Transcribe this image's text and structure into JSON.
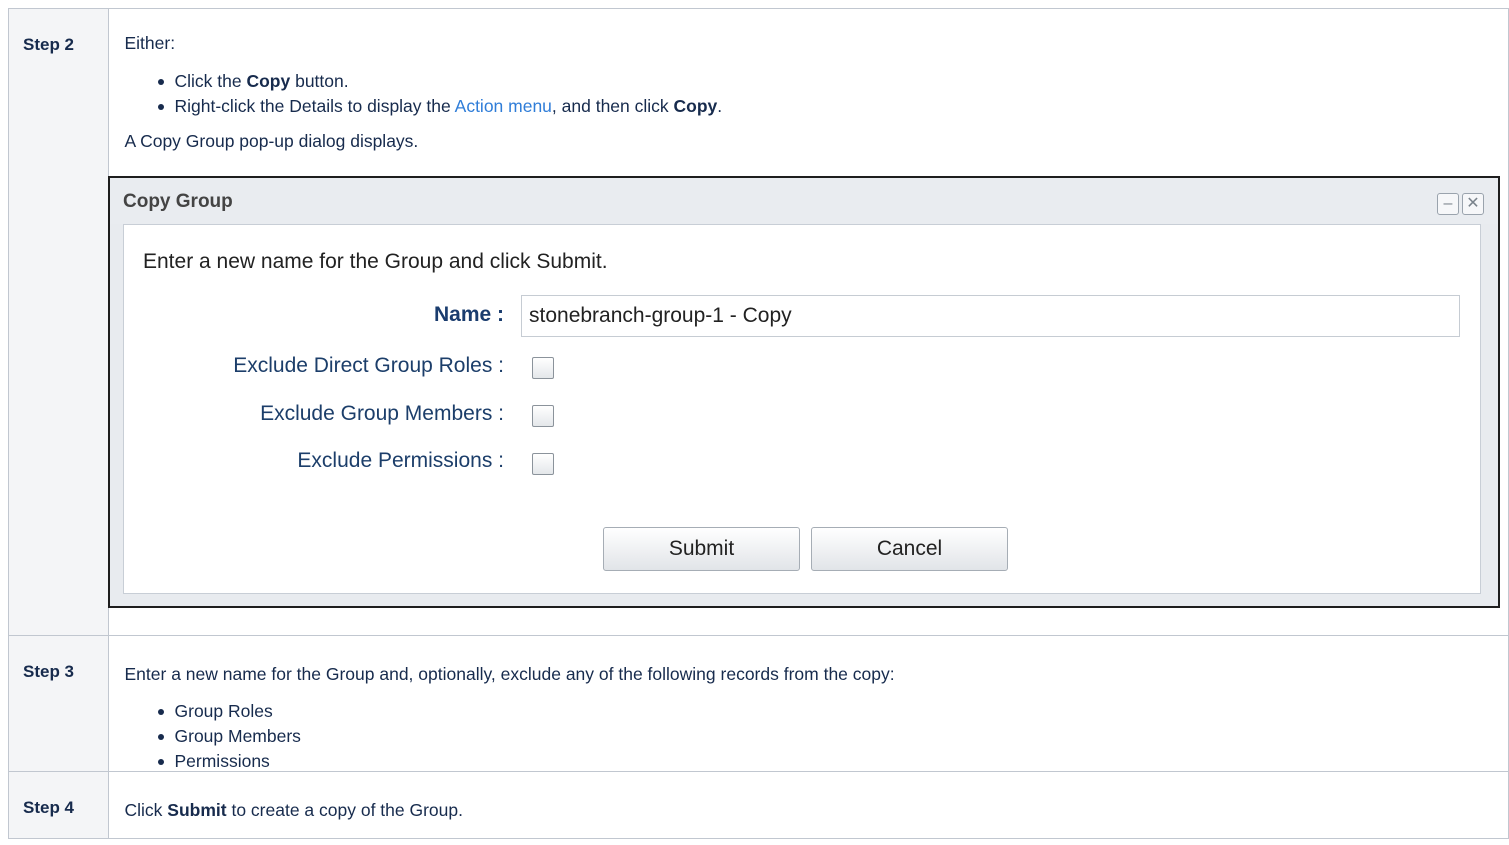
{
  "steps": [
    {
      "label": "Step 2"
    },
    {
      "label": "Step 3"
    },
    {
      "label": "Step 4"
    }
  ],
  "step2": {
    "intro": "Either:",
    "bullet1": {
      "pre": "Click the ",
      "bold": "Copy",
      "post": " button."
    },
    "bullet2": {
      "pre": "Right-click the Details to display the ",
      "link": "Action menu",
      "mid": ", and then click ",
      "bold": "Copy",
      "post": "."
    },
    "outro": "A Copy Group pop-up dialog displays."
  },
  "dialog": {
    "title": "Copy Group",
    "minimize_glyph": "–",
    "close_glyph": "✕",
    "message": "Enter a new name for the Group and click Submit.",
    "name_label": "Name :",
    "name_value": "stonebranch-group-1 - Copy",
    "checkboxes": [
      {
        "label": "Exclude Direct Group Roles :",
        "checked": false
      },
      {
        "label": "Exclude Group Members :",
        "checked": false
      },
      {
        "label": "Exclude Permissions :",
        "checked": false
      }
    ],
    "submit_label": "Submit",
    "cancel_label": "Cancel"
  },
  "step3": {
    "intro": "Enter a new name for the Group and, optionally, exclude any of the following records from the copy:",
    "items": [
      "Group Roles",
      "Group Members",
      "Permissions"
    ]
  },
  "step4": {
    "pre": "Click ",
    "bold": "Submit",
    "post": " to create a copy of the Group."
  },
  "colors": {
    "link": "#2f7dd8",
    "label_bg": "#f4f5f7",
    "border": "#c1c7d0"
  }
}
